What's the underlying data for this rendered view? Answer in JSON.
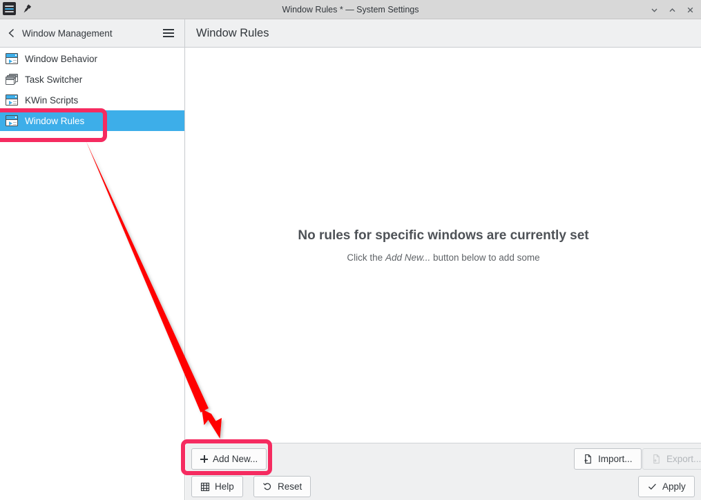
{
  "window": {
    "title": "Window Rules * — System Settings",
    "app_icon": "system-settings-icon",
    "pin_icon": "pin-icon",
    "controls": [
      {
        "name": "minimize-button",
        "icon": "chevron-down-icon"
      },
      {
        "name": "maximize-button",
        "icon": "chevron-up-icon"
      },
      {
        "name": "close-button",
        "icon": "close-x-icon"
      }
    ]
  },
  "header": {
    "back_icon": "chevron-left-icon",
    "breadcrumb": "Window Management",
    "menu_icon": "hamburger-menu-icon",
    "page_title": "Window Rules"
  },
  "sidebar": {
    "items": [
      {
        "label": "Window Behavior",
        "icon": "window-icon",
        "selected": false
      },
      {
        "label": "Task Switcher",
        "icon": "window-stack-icon",
        "selected": false
      },
      {
        "label": "KWin Scripts",
        "icon": "window-icon",
        "selected": false
      },
      {
        "label": "Window Rules",
        "icon": "window-icon",
        "selected": true
      }
    ]
  },
  "content": {
    "empty_title": "No rules for specific windows are currently set",
    "empty_sub_prefix": "Click the ",
    "empty_sub_emphasis": "Add New...",
    "empty_sub_suffix": " button below to add some"
  },
  "footer": {
    "add_new": "Add New...",
    "help": "Help",
    "reset": "Reset",
    "import": "Import...",
    "export": "Export...",
    "apply": "Apply",
    "add_new_icon": "plus-icon",
    "help_icon": "help-book-icon",
    "reset_icon": "undo-arrow-icon",
    "import_icon": "document-import-icon",
    "export_icon": "document-export-icon",
    "apply_icon": "checkmark-icon",
    "export_disabled": true
  },
  "annotations": {
    "highlight_color": "#f52b60",
    "arrow_color": "#ff0000",
    "arrow_from": "Window Rules sidebar item",
    "arrow_to": "Add New... button"
  },
  "colors": {
    "selection": "#3daee9",
    "titlebar": "#d8d8d8",
    "panel": "#eff0f1",
    "text": "#31363b"
  }
}
